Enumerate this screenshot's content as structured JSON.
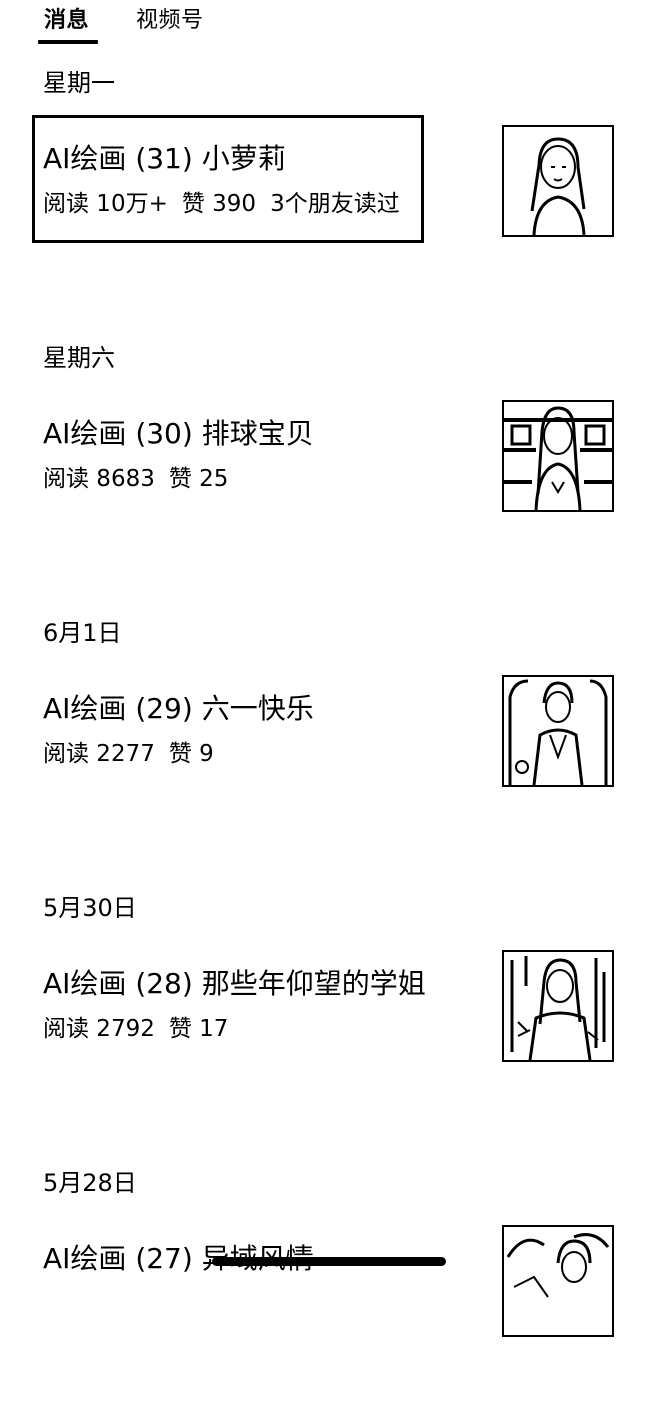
{
  "tabs": {
    "active": "消息",
    "inactive": "视频号"
  },
  "sections": [
    {
      "date": "星期一",
      "title": "AI绘画 (31) 小萝莉",
      "reads": "阅读 10万+",
      "likes": "赞 390",
      "friends": "3个朋友读过",
      "thumb_icon": "portrait-illustration-icon"
    },
    {
      "date": "星期六",
      "title": "AI绘画 (30) 排球宝贝",
      "reads": "阅读 8683",
      "likes": "赞 25",
      "thumb_icon": "portrait-illustration-icon"
    },
    {
      "date": "6月1日",
      "title": "AI绘画 (29) 六一快乐",
      "reads": "阅读 2277",
      "likes": "赞 9",
      "thumb_icon": "portrait-illustration-icon"
    },
    {
      "date": "5月30日",
      "title": "AI绘画 (28) 那些年仰望的学姐",
      "reads": "阅读 2792",
      "likes": "赞 17",
      "thumb_icon": "portrait-illustration-icon"
    },
    {
      "date": "5月28日",
      "title": "AI绘画 (27) 异域风情",
      "thumb_icon": "portrait-illustration-icon"
    }
  ]
}
